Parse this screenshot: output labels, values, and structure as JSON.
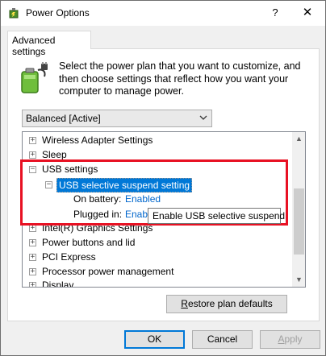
{
  "window": {
    "title": "Power Options",
    "help_label": "?",
    "close_label": "✕"
  },
  "tab": {
    "label": "Advanced settings"
  },
  "description": "Select the power plan that you want to customize, and then choose settings that reflect how you want your computer to manage power.",
  "plan_select": {
    "value": "Balanced [Active]"
  },
  "tree": {
    "rows": [
      {
        "label": "Wireless Adapter Settings",
        "expander": "+"
      },
      {
        "label": "Sleep",
        "expander": "+"
      },
      {
        "label": "USB settings",
        "expander": "−"
      },
      {
        "label": "USB selective suspend setting",
        "expander": "−"
      },
      {
        "label": "On battery:",
        "value": "Enabled"
      },
      {
        "label": "Plugged in:",
        "value": "Enab"
      },
      {
        "label": "Intel(R) Graphics Settings",
        "expander": "+"
      },
      {
        "label": "Power buttons and lid",
        "expander": "+"
      },
      {
        "label": "PCI Express",
        "expander": "+"
      },
      {
        "label": "Processor power management",
        "expander": "+"
      },
      {
        "label": "Display",
        "expander": "+"
      }
    ]
  },
  "tooltip": {
    "text": "Enable USB selective suspend"
  },
  "buttons": {
    "restore": {
      "pre": "",
      "accel": "R",
      "post": "estore plan defaults"
    },
    "ok": "OK",
    "cancel": "Cancel",
    "apply": {
      "accel": "A",
      "post": "pply"
    }
  },
  "colors": {
    "selection": "#0078d7",
    "link": "#0066cc",
    "highlight_box": "#e81123"
  }
}
